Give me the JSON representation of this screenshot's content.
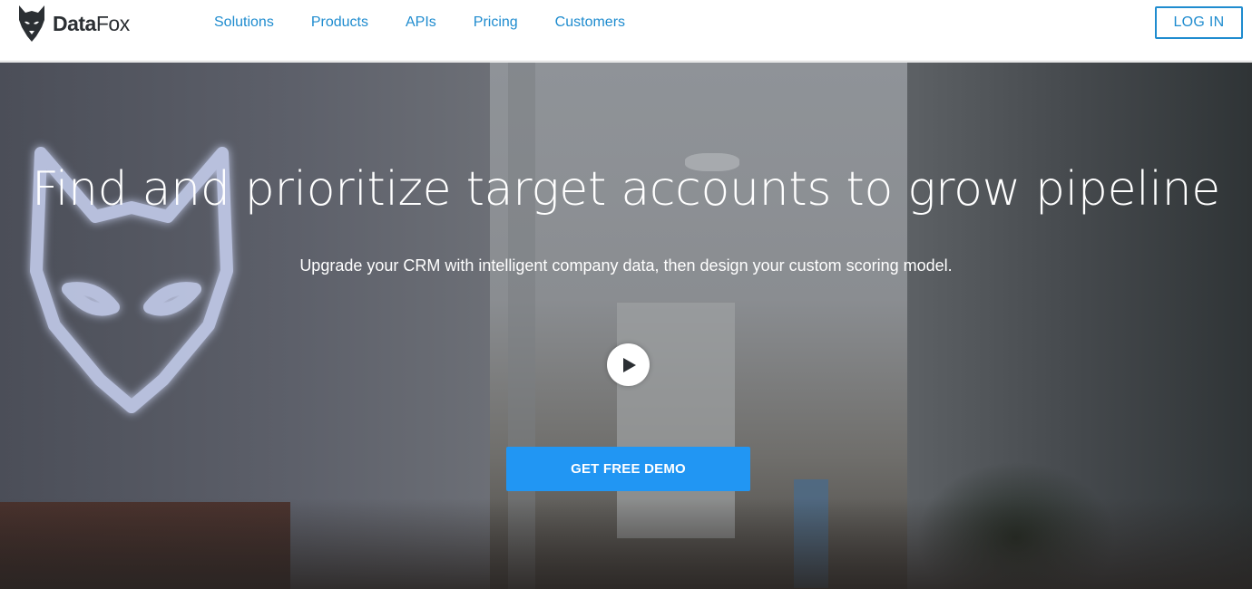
{
  "brand": {
    "name_part1": "Data",
    "name_part2": "Fox"
  },
  "nav": {
    "items": [
      {
        "label": "Solutions"
      },
      {
        "label": "Products"
      },
      {
        "label": "APIs"
      },
      {
        "label": "Pricing"
      },
      {
        "label": "Customers"
      }
    ],
    "login_label": "LOG IN"
  },
  "hero": {
    "title": "Find and prioritize target accounts to grow pipeline",
    "subtitle": "Upgrade your CRM with intelligent company data, then design your custom scoring model.",
    "play_icon": "play-icon",
    "cta_label": "GET FREE DEMO"
  },
  "colors": {
    "accent": "#1f8ccf",
    "cta": "#2196f3",
    "header_bg": "#ffffff"
  }
}
